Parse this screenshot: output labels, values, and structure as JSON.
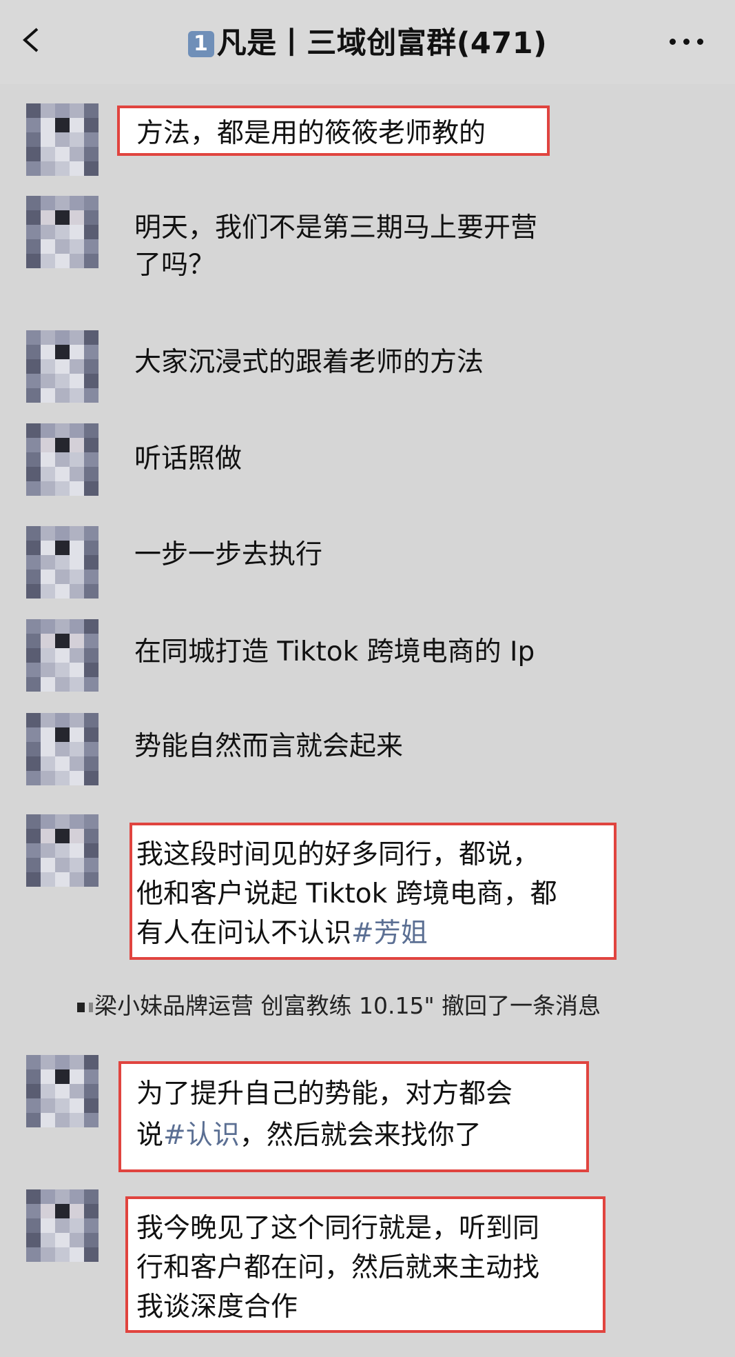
{
  "header": {
    "badge": "1",
    "title": "凡是丨三域创富群(471)"
  },
  "messages": [
    {
      "text": "方法，都是用的筱筱老师教的",
      "highlighted": true
    },
    {
      "text": "明天，我们不是第三期马上要开营\n了吗？",
      "highlighted": false
    },
    {
      "text": "大家沉浸式的跟着老师的方法",
      "highlighted": false
    },
    {
      "text": "听话照做",
      "highlighted": false
    },
    {
      "text": "一步一步去执行",
      "highlighted": false
    },
    {
      "text": "在同城打造 Tiktok 跨境电商的 Ip",
      "highlighted": false
    },
    {
      "text": "势能自然而言就会起来",
      "highlighted": false
    },
    {
      "text_before": "我这段时间见的好多同行，都说，\n他和客户说起 Tiktok 跨境电商，都\n有人在问认不认识",
      "tag": "#芳姐",
      "text_after": "",
      "highlighted": true
    },
    {
      "text_before": "为了提升自己的势能，对方都会\n说",
      "tag": "#认识",
      "text_after": "，然后就会来找你了",
      "highlighted": true
    },
    {
      "text": "我今晚见了这个同行就是，听到同\n行和客户都在问，然后就来主动找\n我谈深度合作",
      "highlighted": true
    }
  ],
  "system_notice": "梁小妹品牌运营 创富教练 10.15\" 撤回了一条消息",
  "colors": {
    "background": "#d6d6d6",
    "highlight_border": "#e0443f",
    "tag": "#5b6f93"
  }
}
